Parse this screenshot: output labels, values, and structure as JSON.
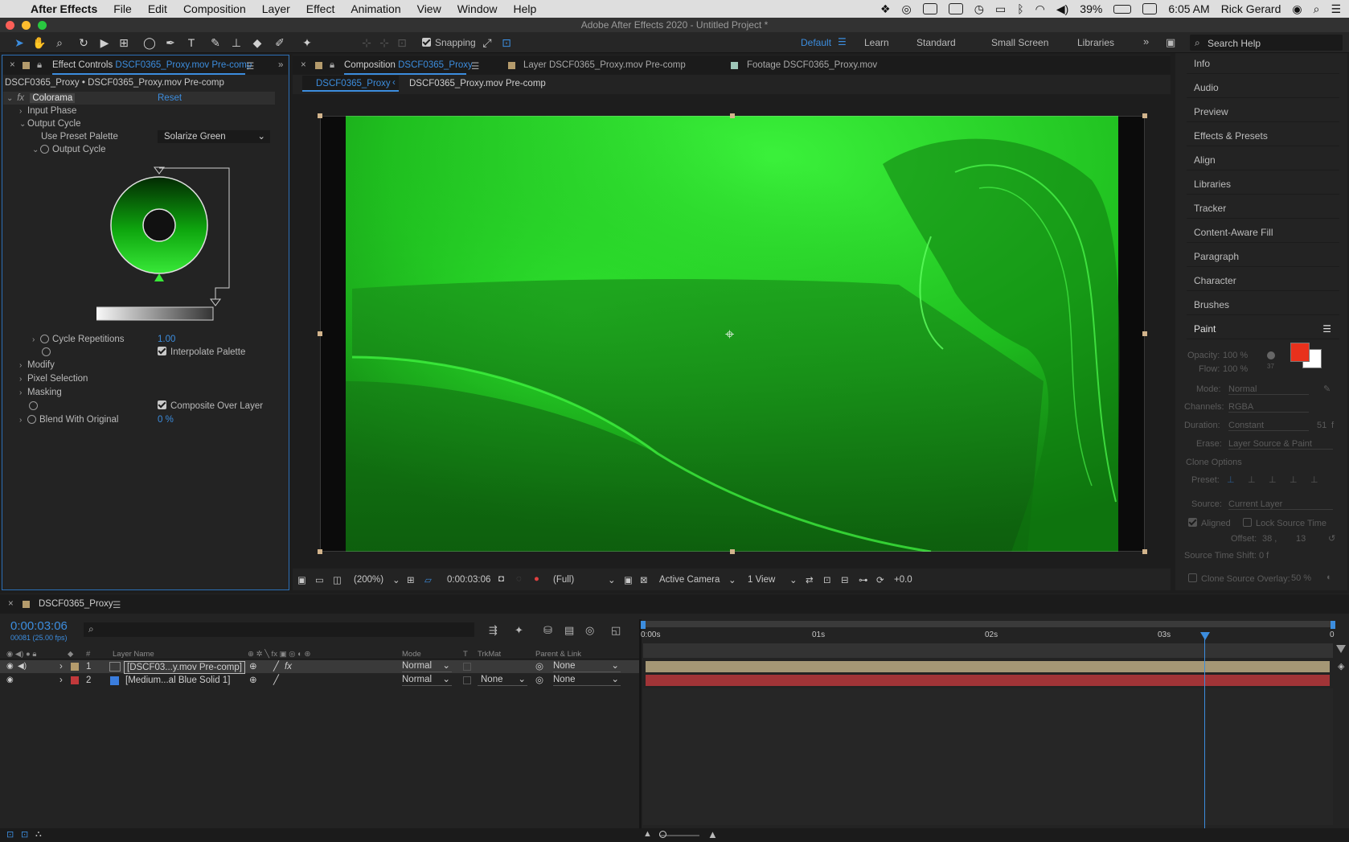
{
  "menubar": {
    "app": "After Effects",
    "items": [
      "File",
      "Edit",
      "Composition",
      "Layer",
      "Effect",
      "Animation",
      "View",
      "Window",
      "Help"
    ],
    "battery": "39%",
    "time": "6:05 AM",
    "user": "Rick Gerard"
  },
  "window_title": "Adobe After Effects 2020 - Untitled Project *",
  "toolbar": {
    "snapping": "Snapping",
    "workspaces": [
      "Default",
      "Learn",
      "Standard",
      "Small Screen",
      "Libraries"
    ],
    "search_placeholder": "Search Help"
  },
  "effect_controls": {
    "tab_prefix": "Effect Controls",
    "tab_name": "DSCF0365_Proxy.mov Pre-comp",
    "header": "DSCF0365_Proxy • DSCF0365_Proxy.mov Pre-comp",
    "effect": "Colorama",
    "reset": "Reset",
    "input_phase": "Input Phase",
    "output_cycle": "Output Cycle",
    "use_preset_palette": "Use Preset Palette",
    "palette_value": "Solarize Green",
    "output_cycle_sub": "Output Cycle",
    "cycle_repetitions": "Cycle Repetitions",
    "cycle_value": "1.00",
    "interpolate": "Interpolate Palette",
    "modify": "Modify",
    "pixel_selection": "Pixel Selection",
    "masking": "Masking",
    "composite": "Composite Over Layer",
    "blend": "Blend With Original",
    "blend_value": "0 %"
  },
  "comp_panel": {
    "tab_prefix": "Composition",
    "tab_name": "DSCF0365_Proxy",
    "layer_tab": "Layer DSCF0365_Proxy.mov Pre-comp",
    "footage_tab": "Footage DSCF0365_Proxy.mov",
    "crumb_active": "DSCF0365_Proxy",
    "crumb_2": "DSCF0365_Proxy.mov Pre-comp",
    "zoom": "(200%)",
    "timecode": "0:00:03:06",
    "resolution": "(Full)",
    "camera": "Active Camera",
    "views": "1 View",
    "exposure": "+0.0"
  },
  "right_panels": [
    "Info",
    "Audio",
    "Preview",
    "Effects & Presets",
    "Align",
    "Libraries",
    "Tracker",
    "Content-Aware Fill",
    "Paragraph",
    "Character",
    "Brushes"
  ],
  "paint": {
    "title": "Paint",
    "opacity": "Opacity:",
    "opacity_val": "100 %",
    "flow": "Flow:",
    "flow_val": "100 %",
    "brush_size": "37",
    "mode": "Mode:",
    "mode_val": "Normal",
    "channels": "Channels:",
    "channels_val": "RGBA",
    "duration": "Duration:",
    "duration_val": "Constant",
    "duration_num": "51",
    "duration_unit": "f",
    "erase": "Erase:",
    "erase_val": "Layer Source & Paint",
    "clone_options": "Clone Options",
    "preset": "Preset:",
    "source": "Source:",
    "source_val": "Current Layer",
    "aligned": "Aligned",
    "lock": "Lock Source Time",
    "offset": "Offset:",
    "offset_x": "38 ,",
    "offset_y": "13",
    "shift": "Source Time Shift:",
    "shift_val": "0 f",
    "overlay": "Clone Source Overlay:",
    "overlay_val": "50 %",
    "fg_color": "#e8311c",
    "bg_color": "#ffffff"
  },
  "timeline": {
    "tab": "DSCF0365_Proxy",
    "timecode": "0:00:03:06",
    "frames": "00081 (25.00 fps)",
    "cols": {
      "num": "#",
      "layer_name": "Layer Name",
      "mode": "Mode",
      "t": "T",
      "trkmat": "TrkMat",
      "parent": "Parent & Link"
    },
    "ruler": [
      "0:00s",
      "01s",
      "02s",
      "03s",
      "0"
    ],
    "layers": [
      {
        "num": "1",
        "name": "[DSCF03...y.mov Pre-comp]",
        "mode": "Normal",
        "trkmat": "",
        "parent": "None",
        "label_color": "#b49b6c"
      },
      {
        "num": "2",
        "name": "[Medium...al Blue Solid 1]",
        "mode": "Normal",
        "trkmat": "None",
        "parent": "None",
        "label_color": "#c2393b"
      }
    ]
  }
}
